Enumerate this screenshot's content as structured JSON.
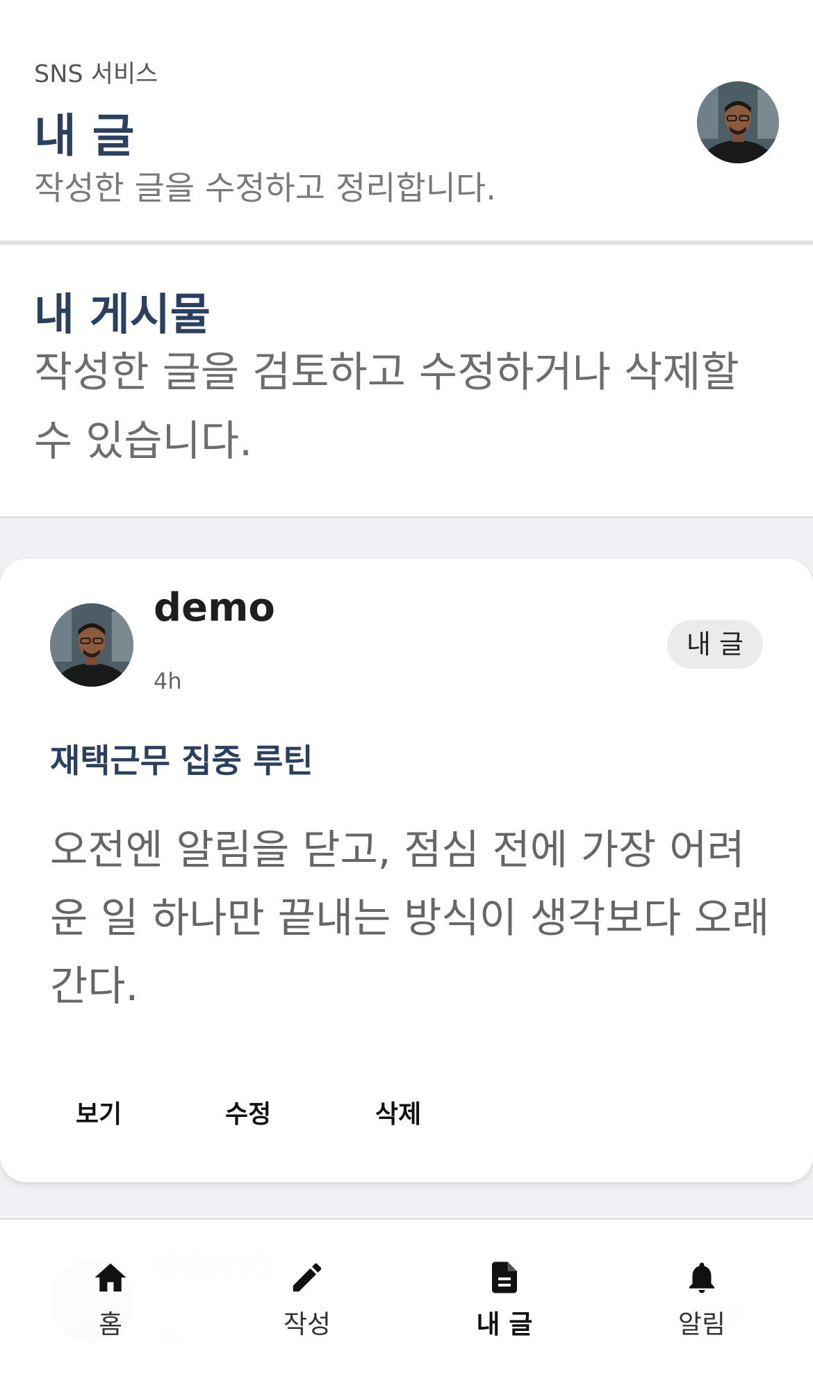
{
  "header": {
    "service_name": "SNS 서비스",
    "title": "내 글",
    "subtitle": "작성한 글을 수정하고 정리합니다.",
    "avatar_icon": "user-avatar"
  },
  "intro": {
    "title": "내 게시물",
    "description": "작성한 글을 검토하고 수정하거나 삭제할 수 있습니다."
  },
  "posts": [
    {
      "author": "demo",
      "time": "4h",
      "badge": "내 글",
      "title": "재택근무 집중 루틴",
      "body": "오전엔 알림을 닫고, 점심 전에 가장 어려운 일 하나만 끝내는 방식이 생각보다 오래 간다.",
      "actions": {
        "view": "보기",
        "edit": "수정",
        "delete": "삭제"
      }
    },
    {
      "author": "demo",
      "time": "9h",
      "badge": "내 글"
    }
  ],
  "nav": {
    "items": [
      {
        "label": "홈",
        "icon": "home-icon",
        "active": false
      },
      {
        "label": "작성",
        "icon": "pencil-icon",
        "active": false
      },
      {
        "label": "내 글",
        "icon": "document-icon",
        "active": true
      },
      {
        "label": "알림",
        "icon": "bell-icon",
        "active": false
      }
    ]
  },
  "colors": {
    "accent": "#2b3f5e",
    "page_background": "#eff1f5",
    "badge_background": "#ebebeb"
  }
}
